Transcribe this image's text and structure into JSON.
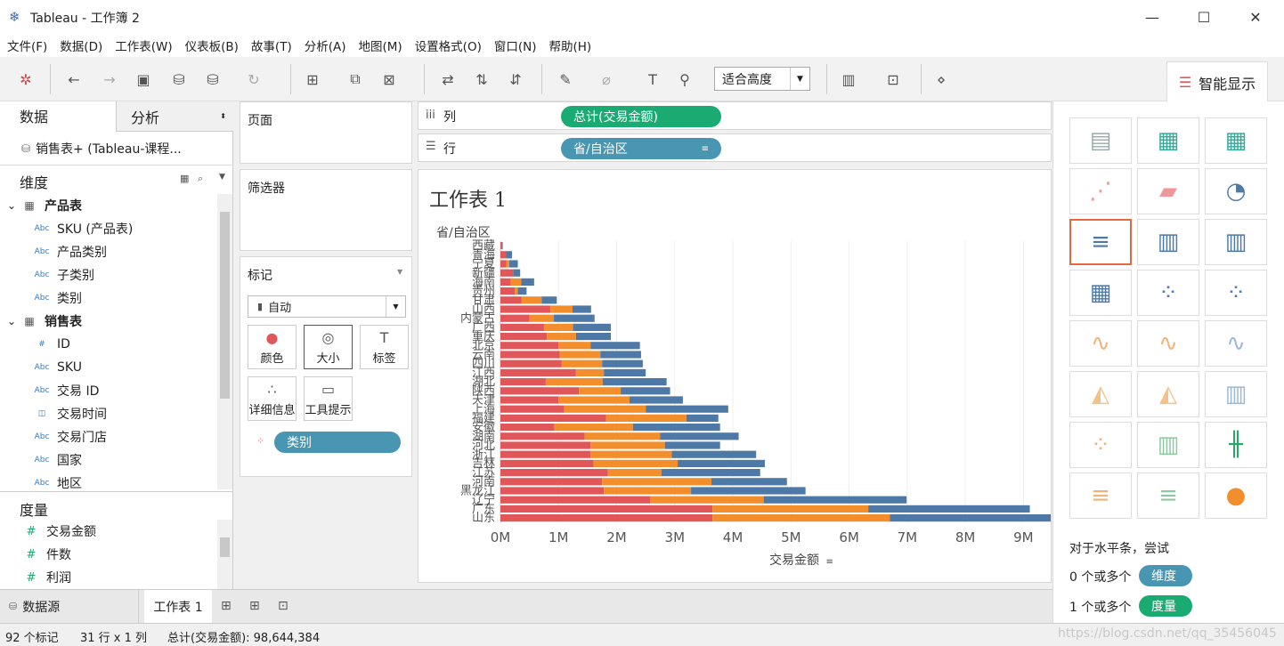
{
  "window": {
    "title": "Tableau - 工作簿 2",
    "minimize": "—",
    "maximize": "☐",
    "close": "✕"
  },
  "menu": [
    "文件(F)",
    "数据(D)",
    "工作表(W)",
    "仪表板(B)",
    "故事(T)",
    "分析(A)",
    "地图(M)",
    "设置格式(O)",
    "窗口(N)",
    "帮助(H)"
  ],
  "toolbar": {
    "fit_value": "适合高度"
  },
  "smart_show": {
    "tab_label": "智能显示",
    "hint": "对于水平条，尝试",
    "req_dim_text": "0 个或多个",
    "req_dim_pill": "维度",
    "req_mea_text": "1 个或多个",
    "req_mea_pill": "度量"
  },
  "left": {
    "tab_data": "数据",
    "tab_analysis": "分析",
    "datasource": "销售表+ (Tableau-课程...",
    "dimensions_title": "维度",
    "dimensions": [
      {
        "label": "产品表",
        "icon": "▦",
        "group": true
      },
      {
        "label": "SKU (产品表)",
        "icon": "Abc"
      },
      {
        "label": "产品类别",
        "icon": "Abc"
      },
      {
        "label": "子类别",
        "icon": "Abc"
      },
      {
        "label": "类别",
        "icon": "Abc"
      },
      {
        "label": "销售表",
        "icon": "▦",
        "group": true
      },
      {
        "label": "ID",
        "icon": "#"
      },
      {
        "label": "SKU",
        "icon": "Abc"
      },
      {
        "label": "交易 ID",
        "icon": "Abc"
      },
      {
        "label": "交易时间",
        "icon": "◫"
      },
      {
        "label": "交易门店",
        "icon": "Abc"
      },
      {
        "label": "国家",
        "icon": "Abc"
      },
      {
        "label": "地区",
        "icon": "Abc"
      }
    ],
    "measures_title": "度量",
    "measures": [
      "交易金额",
      "件数",
      "利润"
    ]
  },
  "cards": {
    "pages": "页面",
    "filters": "筛选器",
    "marks": "标记",
    "mark_type": "自动",
    "btn_color": "颜色",
    "btn_size": "大小",
    "btn_label": "标签",
    "btn_detail": "详细信息",
    "btn_tooltip": "工具提示",
    "color_pill": "类别"
  },
  "shelves": {
    "columns_label": "列",
    "columns_pill": "总计(交易金额)",
    "rows_label": "行",
    "rows_pill": "省/自治区"
  },
  "colors": {
    "red": "#e15759",
    "orange": "#f28e2b",
    "blue": "#4e79a7",
    "green": "#1aab73",
    "teal": "#4996b2"
  },
  "chart_data": {
    "type": "bar",
    "orientation": "horizontal",
    "stacked": true,
    "title": "工作表 1",
    "row_header": "省/自治区",
    "xlabel": "交易金额",
    "xlim": [
      0,
      9.5
    ],
    "xticks": [
      "0M",
      "1M",
      "2M",
      "3M",
      "4M",
      "5M",
      "6M",
      "7M",
      "8M",
      "9M"
    ],
    "categories": [
      "西藏",
      "青海",
      "宁夏",
      "新疆",
      "海南",
      "贵州",
      "甘肃",
      "山西",
      "内蒙古",
      "广西",
      "重庆",
      "北京",
      "云南",
      "四川",
      "江西",
      "湖北",
      "陕西",
      "天津",
      "上海",
      "福建",
      "安徽",
      "湖南",
      "河北",
      "浙江",
      "吉林",
      "江苏",
      "河南",
      "黑龙江",
      "辽宁",
      "广东",
      "山东"
    ],
    "series": [
      {
        "color": "#e15759",
        "values": [
          0.03,
          0.1,
          0.1,
          0.22,
          0.18,
          0.25,
          0.36,
          0.86,
          0.5,
          0.75,
          0.8,
          1.0,
          1.02,
          1.05,
          1.3,
          0.78,
          1.35,
          1.0,
          1.1,
          1.82,
          0.93,
          1.45,
          1.55,
          1.55,
          1.6,
          1.85,
          1.75,
          1.78,
          2.58,
          3.65,
          3.65
        ]
      },
      {
        "color": "#f28e2b",
        "values": [
          0.0,
          0.0,
          0.05,
          0.0,
          0.18,
          0.05,
          0.35,
          0.38,
          0.42,
          0.5,
          0.5,
          0.55,
          0.7,
          0.7,
          0.48,
          0.98,
          0.72,
          1.22,
          1.4,
          1.38,
          1.35,
          1.3,
          1.28,
          1.4,
          1.45,
          0.92,
          1.88,
          1.5,
          1.95,
          2.68,
          3.05
        ]
      },
      {
        "color": "#4e79a7",
        "values": [
          0.01,
          0.1,
          0.15,
          0.12,
          0.22,
          0.15,
          0.26,
          0.32,
          0.7,
          0.65,
          0.6,
          0.85,
          0.7,
          0.7,
          0.72,
          1.1,
          0.85,
          0.92,
          1.42,
          0.55,
          1.5,
          1.35,
          0.95,
          1.45,
          1.5,
          1.7,
          1.3,
          1.97,
          2.46,
          2.78,
          3.0
        ]
      }
    ]
  },
  "bottom": {
    "datasource_tab": "数据源",
    "sheet_tab": "工作表 1"
  },
  "status": {
    "marks": "92 个标记",
    "rows_cols": "31 行 x 1 列",
    "sum": "总计(交易金额): 98,644,384",
    "watermark": "https://blog.csdn.net/qq_35456045"
  }
}
